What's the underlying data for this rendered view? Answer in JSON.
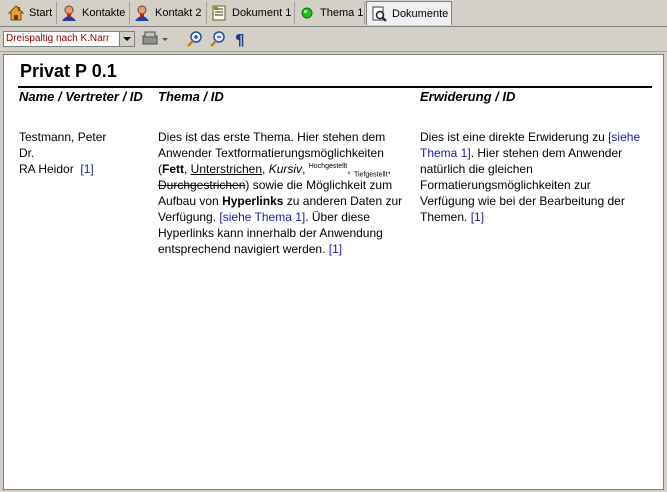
{
  "tabs": [
    {
      "label": "Start",
      "icon": "house-icon"
    },
    {
      "label": "Kontakte",
      "icon": "person-icon"
    },
    {
      "label": "Kontakt 2",
      "icon": "person-icon"
    },
    {
      "label": "Dokument 1",
      "icon": "document-icon"
    },
    {
      "label": "Thema 1",
      "icon": "green-dot-icon"
    },
    {
      "label": "Dokumente",
      "icon": "magnifier-document-icon"
    }
  ],
  "toolbar": {
    "layout_select": "Dreispaltig nach K.Narr"
  },
  "document": {
    "title": "Privat P 0.1",
    "col1_header": "Name / Vertreter / ID",
    "col2_header": "Thema / ID",
    "col3_header": "Erwiderung / ID",
    "col1": {
      "line1": "Testmann, Peter",
      "line2": "Dr.",
      "line3": "RA Heidor",
      "link": "[1]"
    },
    "col2": {
      "t1": "Dies ist das erste Thema. Hier stehen dem Anwender Textformatierungsmöglichkeiten (",
      "bold": "Fett",
      "comma1": ", ",
      "underline": "Unterstrichen",
      "comma2": ", ",
      "italic": "Kursiv",
      "comma3": ", ",
      "sup": "Hochgestellt",
      "comma4": ", ",
      "sub": "Tiefgestellt",
      "comma5": ", ",
      "strike": "Durchgestrichen",
      "t2": ") sowie die Möglichkeit zum Aufbau von ",
      "bold2": "Hyperlinks",
      "t3": " zu anderen Daten zur Verfügung. ",
      "link1": "[siehe Thema 1]",
      "t4": ". Über diese Hyperlinks kann innerhalb der Anwendung entsprechend navigiert werden. ",
      "link2": "[1]"
    },
    "col3": {
      "t1": "Dies ist eine direkte Erwiderung zu ",
      "link1": "[siehe Thema 1]",
      "t2": ". Hier stehen dem Anwender natürlich die gleichen Formatierungsmöglichkeiten zur Verfügung wie bei der Bearbeitung der Themen. ",
      "link2": "[1]"
    }
  }
}
